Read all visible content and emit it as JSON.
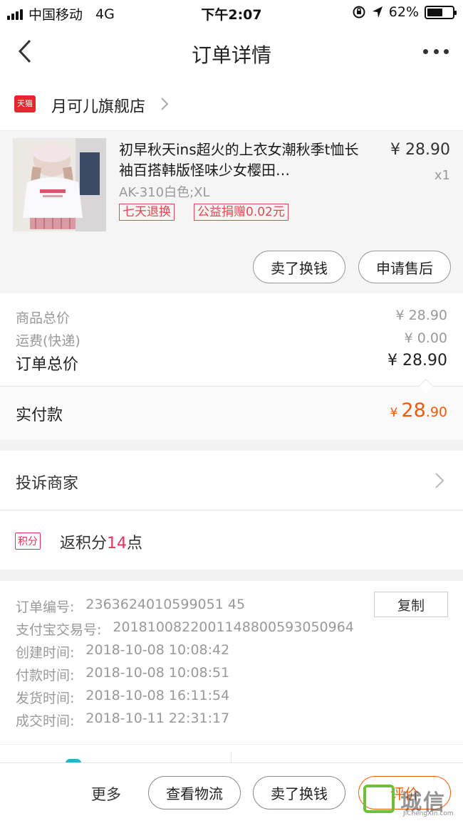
{
  "status_bar": {
    "carrier": "中国移动",
    "network": "4G",
    "time": "下午2:07",
    "battery": "62%",
    "battery_level": 0.62
  },
  "nav": {
    "title": "订单详情"
  },
  "shop": {
    "badge": "天猫",
    "name": "月可儿旗舰店"
  },
  "item": {
    "title": "初早秋天ins超火的上衣女潮秋季t恤长袖百搭韩版怪味少女樱田…",
    "price": "¥ 28.90",
    "quantity": "x1",
    "sku": "AK-310白色;XL",
    "tags": [
      "七天退换",
      "公益捐赠0.02元"
    ],
    "buttons": [
      "卖了换钱",
      "申请售后"
    ]
  },
  "summary": {
    "goods_label": "商品总价",
    "goods_value": "¥ 28.90",
    "shipping_label": "运费(快递)",
    "shipping_value": "¥ 0.00",
    "total_label": "订单总价",
    "total_value": "¥ 28.90",
    "paid_label": "实付款",
    "paid_currency": "¥",
    "paid_int": "28",
    "paid_dec": ".90"
  },
  "complain": {
    "label": "投诉商家"
  },
  "points": {
    "badge": "积分",
    "prefix": "返积分",
    "number": "14",
    "suffix": "点"
  },
  "order_info": {
    "copy_label": "复制",
    "rows": [
      {
        "label": "订单编号:",
        "value": "2363624010599051 45"
      },
      {
        "label": "支付宝交易号:",
        "value": "2018100822001148800593050964"
      },
      {
        "label": "创建时间:",
        "value": "2018-10-08 10:08:42"
      },
      {
        "label": "付款时间:",
        "value": "2018-10-08 10:08:51"
      },
      {
        "label": "发货时间:",
        "value": "2018-10-08 16:11:54"
      },
      {
        "label": "成交时间:",
        "value": "2018-10-11 22:31:17"
      }
    ]
  },
  "bottom_bar": {
    "more": "更多",
    "logistics": "查看物流",
    "sell": "卖了换钱",
    "rate": "评价"
  },
  "watermark": {
    "text": "城信",
    "sub": "JiChengXin.com"
  }
}
